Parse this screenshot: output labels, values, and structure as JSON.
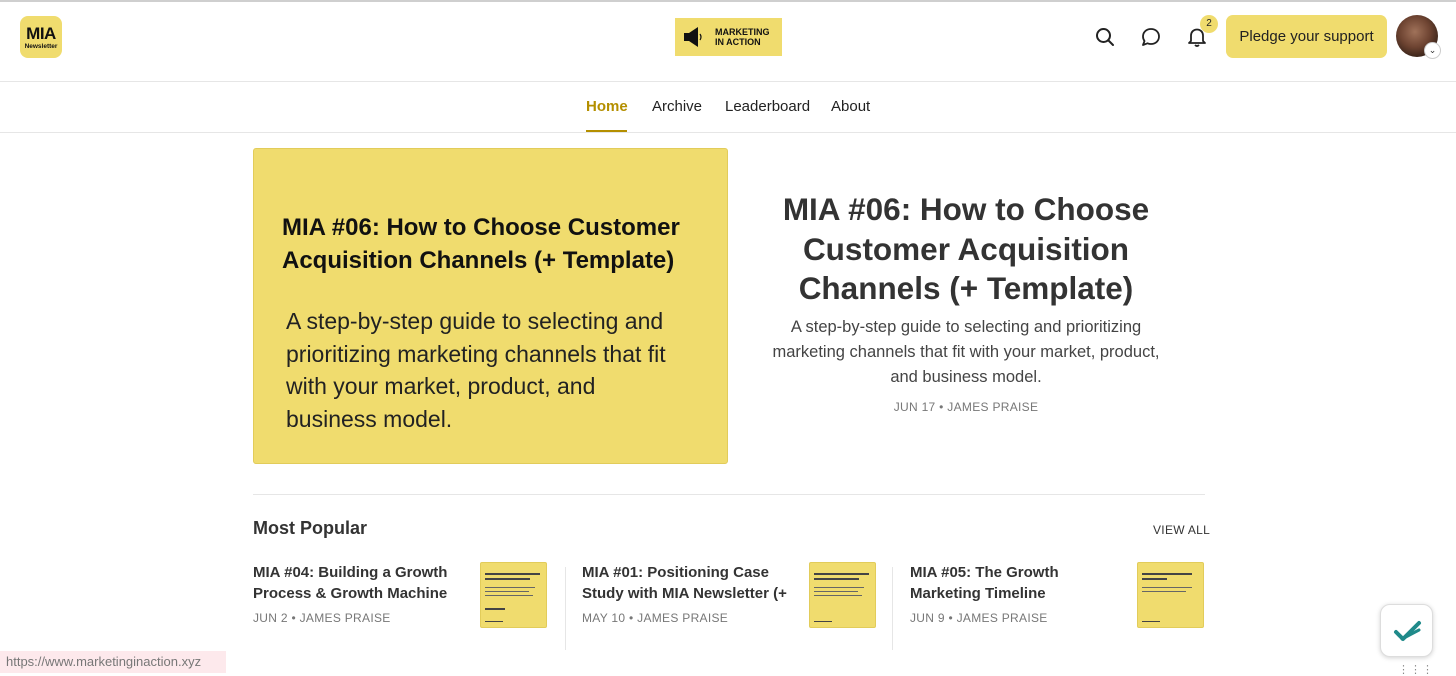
{
  "header": {
    "logo_big": "MIA",
    "logo_small": "Newsletter",
    "brand_line1": "MARKETING",
    "brand_line2": "IN ACTION",
    "notification_count": "2",
    "pledge_label": "Pledge your support"
  },
  "nav": {
    "items": [
      {
        "label": "Home",
        "active": true
      },
      {
        "label": "Archive"
      },
      {
        "label": "Leaderboard"
      },
      {
        "label": "About"
      }
    ]
  },
  "hero": {
    "card_title": "MIA #06: How to Choose Customer Acquisition Channels (+ Template)",
    "card_description": "A step-by-step guide to selecting and prioritizing marketing channels that fit with your market, product, and business model.",
    "title": "MIA #06: How to Choose Customer Acquisition Channels (+ Template)",
    "subtitle": "A step-by-step guide to selecting and prioritizing marketing channels that fit with your market, product, and business model.",
    "meta": "JUN 17 • JAMES PRAISE"
  },
  "most_popular": {
    "heading": "Most Popular",
    "view_all": "VIEW ALL",
    "posts": [
      {
        "title": "MIA #04: Building a Growth Process & Growth Machine (+ Template)",
        "meta": "JUN 2 • JAMES PRAISE"
      },
      {
        "title": "MIA #01: Positioning Case Study with MIA Newsletter (+ Template)",
        "meta": "MAY 10 • JAMES PRAISE"
      },
      {
        "title": "MIA #05: The Growth Marketing Timeline",
        "meta": "JUN 9 • JAMES PRAISE"
      }
    ]
  },
  "status_bar": {
    "url": "https://www.marketinginaction.xyz"
  },
  "colors": {
    "accent": "#f0dc6e",
    "active_nav": "#b48f00"
  },
  "icons": [
    "search-icon",
    "chat-icon",
    "bell-icon",
    "speaker-icon",
    "checkmark-icon"
  ]
}
